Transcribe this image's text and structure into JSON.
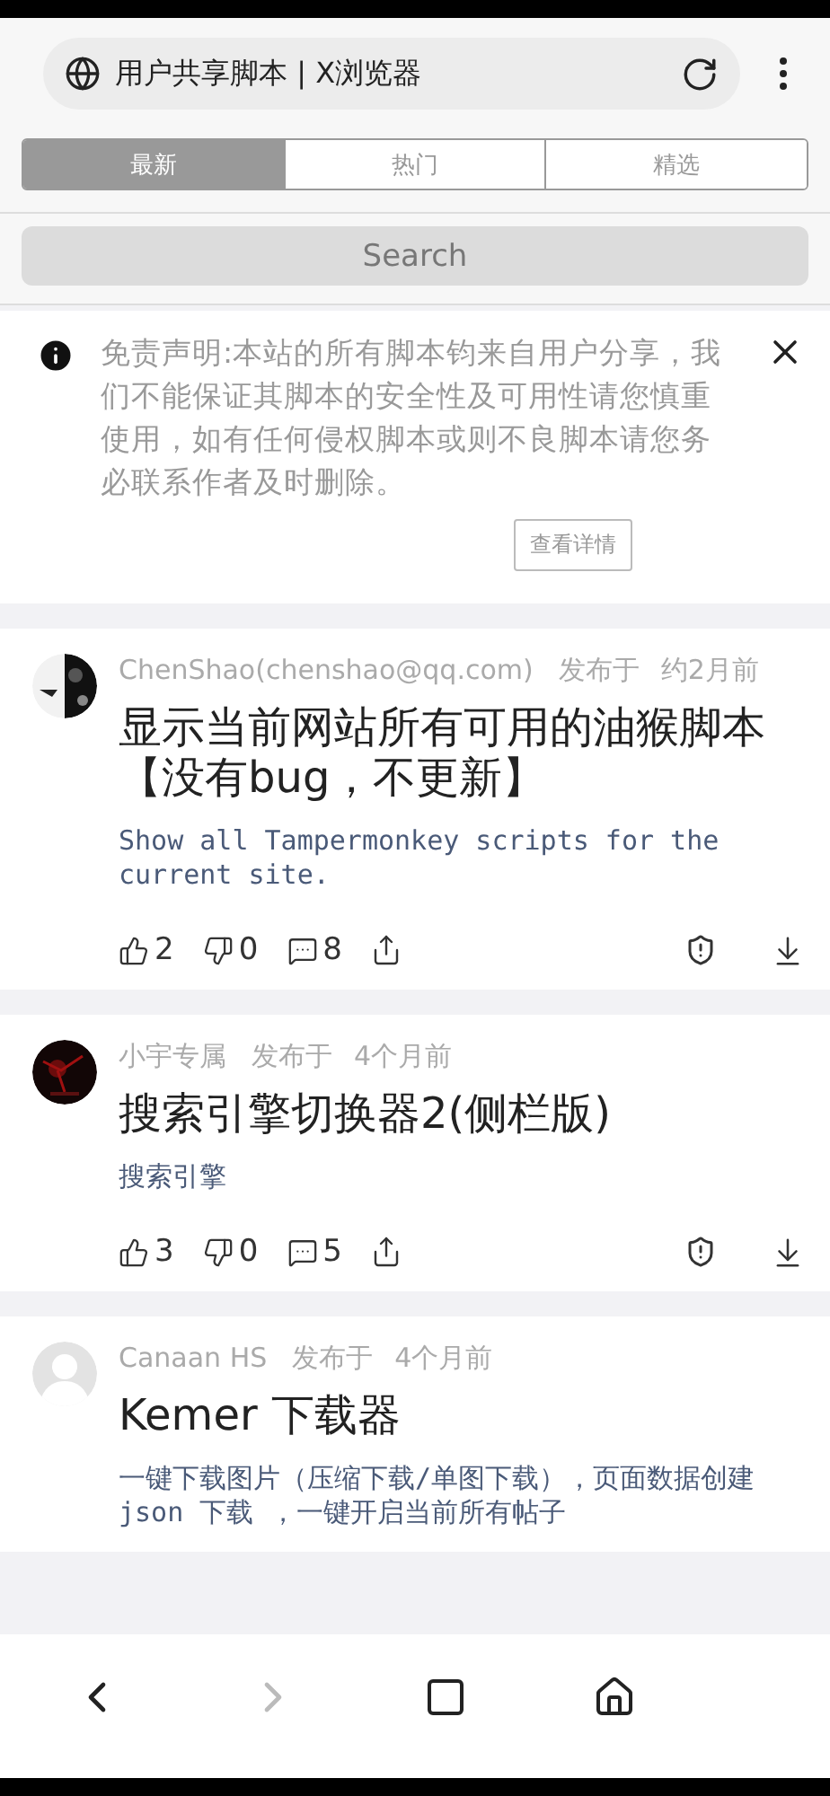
{
  "browser": {
    "title": "用户共享脚本 | X浏览器"
  },
  "tabs": [
    {
      "label": "最新",
      "selected": true
    },
    {
      "label": "热门",
      "selected": false
    },
    {
      "label": "精选",
      "selected": false
    }
  ],
  "search": {
    "placeholder": "Search"
  },
  "notice": {
    "text": "免责声明:本站的所有脚本钧来自用户分享，我们不能保证其脚本的安全性及可用性请您慎重使用，如有任何侵权脚本或则不良脚本请您务必联系作者及时删除。",
    "button": "查看详情"
  },
  "scripts": [
    {
      "author": "ChenShao(chenshao@qq.com)",
      "published": "发布于",
      "time": "约2月前",
      "title": "显示当前网站所有可用的油猴脚本【没有bug，不更新】",
      "description": "Show all Tampermonkey scripts for the current site.",
      "actions": {
        "likes": "2",
        "dislikes": "0",
        "comments": "8"
      }
    },
    {
      "author": "小宇专属",
      "published": "发布于",
      "time": "4个月前",
      "title": "搜索引擎切换器2(侧栏版)",
      "description": "搜索引擎",
      "actions": {
        "likes": "3",
        "dislikes": "0",
        "comments": "5"
      }
    },
    {
      "avatar": {
        "kind": "silhouette"
      },
      "author": "Canaan HS",
      "published": "发布于",
      "time": "4个月前",
      "title": "Kemer 下载器",
      "description": "一键下载图片（压缩下载/单图下载），页面数据创建 json 下载 ，一键开启当前所有帖子"
    }
  ],
  "navigation": {
    "back_enabled": true,
    "forward_enabled": false
  }
}
